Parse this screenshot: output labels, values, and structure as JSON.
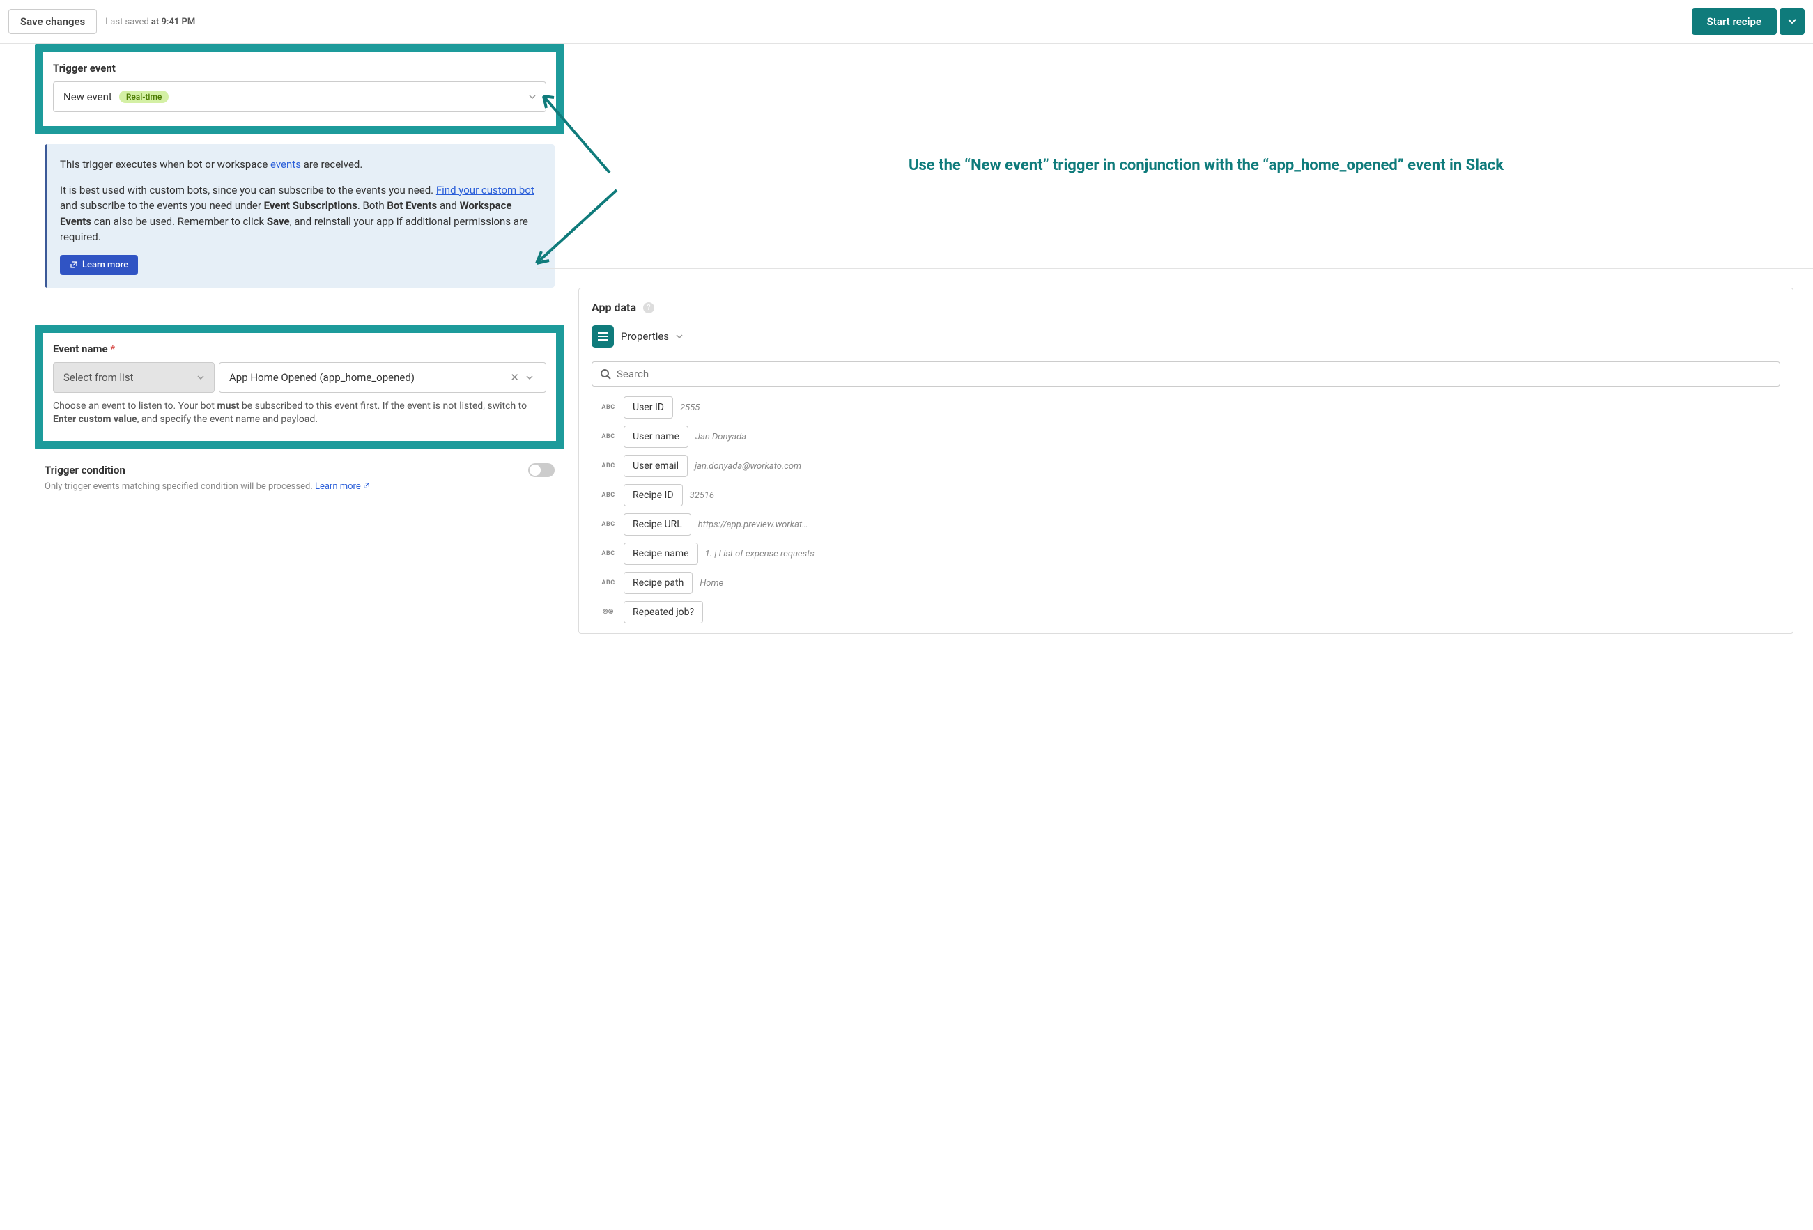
{
  "header": {
    "save_button": "Save changes",
    "last_saved_prefix": "Last saved ",
    "last_saved_time": "at 9:41 PM",
    "start_recipe": "Start recipe"
  },
  "trigger": {
    "label": "Trigger event",
    "value": "New event",
    "badge": "Real-time"
  },
  "info": {
    "line1_a": "This trigger executes when bot or workspace ",
    "line1_link": "events",
    "line1_b": " are received.",
    "line2_a": "It is best used with custom bots, since you can subscribe to the events you need. ",
    "line2_link": "Find your custom bot",
    "line2_b": " and subscribe to the events you need under ",
    "line2_c": "Event Subscriptions",
    "line2_d": ". Both ",
    "line2_e": "Bot Events",
    "line2_f": " and ",
    "line2_g": "Workspace Events",
    "line2_h": " can also be used. Remember to click ",
    "line2_i": "Save",
    "line2_j": ", and reinstall your app if additional permissions are required.",
    "learn_more": "Learn more"
  },
  "event": {
    "label": "Event name",
    "select_from_list": "Select from list",
    "value": "App Home Opened (app_home_opened)",
    "help_a": "Choose an event to listen to. Your bot ",
    "help_b": "must",
    "help_c": " be subscribed to this event first. If the event is not listed, switch to ",
    "help_d": "Enter custom value",
    "help_e": ", and specify the event name and payload."
  },
  "trigger_condition": {
    "label": "Trigger condition",
    "sub": "Only trigger events matching specified condition will be processed. ",
    "learn_more": "Learn more"
  },
  "annotation": {
    "text": "Use the “New event” trigger in conjunction with the “app_home_opened” event in Slack"
  },
  "app_data": {
    "title": "App data",
    "properties": "Properties",
    "search_placeholder": "Search",
    "abc": "ABC",
    "ring": "⦾⦿",
    "rows": [
      {
        "type": "abc",
        "label": "User ID",
        "sample": "2555"
      },
      {
        "type": "abc",
        "label": "User name",
        "sample": "Jan Donyada"
      },
      {
        "type": "abc",
        "label": "User email",
        "sample": "jan.donyada@workato.com"
      },
      {
        "type": "abc",
        "label": "Recipe ID",
        "sample": "32516"
      },
      {
        "type": "abc",
        "label": "Recipe URL",
        "sample": "https://app.preview.workat…"
      },
      {
        "type": "abc",
        "label": "Recipe name",
        "sample": "1. | List of expense requests"
      },
      {
        "type": "abc",
        "label": "Recipe path",
        "sample": "Home"
      },
      {
        "type": "ring",
        "label": "Repeated job?",
        "sample": ""
      }
    ]
  }
}
